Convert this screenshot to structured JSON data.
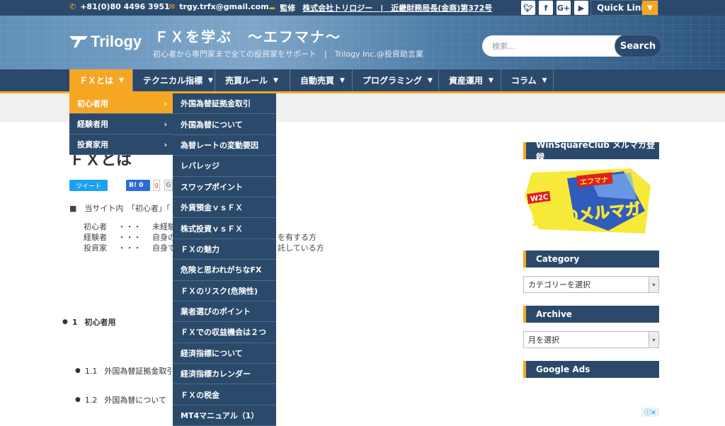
{
  "topbar": {
    "phone": "+81(0)80 4496 3951",
    "email": "trgy.trfx@gmail.com",
    "supervision_label": "監修",
    "supervision_company": "株式会社トリロジー　|　近畿財務局長(金商)第372号",
    "social": [
      "twitter",
      "facebook",
      "G+",
      "youtube"
    ],
    "quick_links": "Quick Links"
  },
  "header": {
    "logo_text": "Trilogy",
    "site_title": "ＦＸを学ぶ　～エフマナ～",
    "tagline": "初心者から専門家まで全ての投資家をサポート　|　Trilogy Inc.@投資助言業",
    "search_placeholder": "検索...",
    "search_button": "Search"
  },
  "nav": [
    {
      "label": "ＦＸとは",
      "active": true
    },
    {
      "label": "テクニカル指標",
      "active": false
    },
    {
      "label": "売買ルール",
      "active": false
    },
    {
      "label": "自動売買",
      "active": false
    },
    {
      "label": "プログラミング",
      "active": false
    },
    {
      "label": "資産運用",
      "active": false
    },
    {
      "label": "コラム",
      "active": false
    }
  ],
  "submenu_level1": [
    {
      "label": "初心者用",
      "active": true
    },
    {
      "label": "経験者用",
      "active": false
    },
    {
      "label": "投資家用",
      "active": false
    }
  ],
  "submenu_level2": [
    "外国為替証拠金取引",
    "外国為替について",
    "為替レートの変動要因",
    "レバレッジ",
    "スワップポイント",
    "外貨預金ｖｓＦＸ",
    "株式投資ｖｓＦＸ",
    "ＦＸの魅力",
    "危険と思われがちなFX",
    "ＦＸのリスク(危険性)",
    "業者選びのポイント",
    "ＦＸでの収益機会は２つ",
    "経済指標について",
    "経済指標カレンダー",
    "ＦＸの税金",
    "MT4マニュアル（1）"
  ],
  "content": {
    "title": "ＦＸとは",
    "tweet": "ツイート",
    "hatena": "B! 0",
    "intro": "■　当サイト内　「初心者」「",
    "definitions": [
      {
        "term": "初心者",
        "sep": "・・・",
        "desc": "未経験者"
      },
      {
        "term": "経験者",
        "sep": "・・・",
        "desc": "自身の売買",
        "tail": "を有する方"
      },
      {
        "term": "投資家",
        "sep": "・・・",
        "desc": "自身での",
        "tail": "託している方"
      }
    ],
    "toc": [
      {
        "num": "1",
        "label": "初心者用"
      },
      {
        "num": "1.1",
        "label": "外国為替証拠金取引"
      },
      {
        "num": "1.2",
        "label": "外国為替について"
      }
    ]
  },
  "sidebar": {
    "mailmag_title": "WinSquareClub メルマガ登録",
    "mailmag_banner": {
      "tag1": "W2C",
      "tag2": "エフマナ",
      "main": "最強のメルマガ"
    },
    "category_title": "Category",
    "category_select": "カテゴリーを選択",
    "archive_title": "Archive",
    "archive_select": "月を選択",
    "ads_title": "Google Ads"
  },
  "colors": {
    "navy": "#2b4a6b",
    "orange": "#f5a623"
  }
}
